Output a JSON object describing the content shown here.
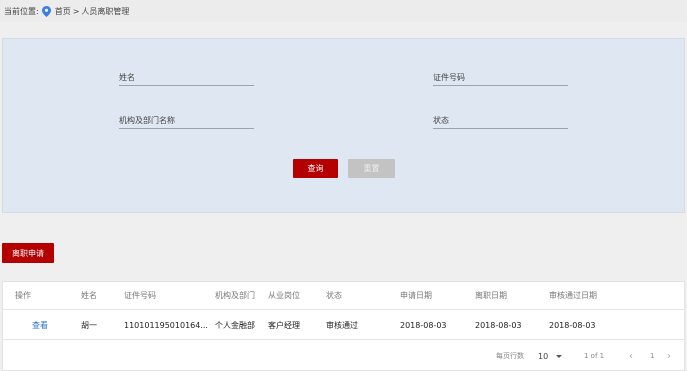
{
  "breadcrumb": {
    "label": "当前位置:",
    "home": "首页",
    "separator": ">",
    "current": "人员离职管理"
  },
  "search": {
    "name_placeholder": "姓名",
    "id_placeholder": "证件号码",
    "org_placeholder": "机构及部门名称",
    "status_placeholder": "状态",
    "query_label": "查询",
    "reset_label": "重置"
  },
  "actions": {
    "resign_label": "离职申请"
  },
  "table": {
    "columns": [
      "操作",
      "姓名",
      "证件号码",
      "机构及部门",
      "从业岗位",
      "状态",
      "申请日期",
      "离职日期",
      "审核通过日期"
    ],
    "rows": [
      {
        "action": "查看",
        "name": "胡一",
        "id_number": "110101195010164...",
        "org": "个人金融部",
        "position": "客户经理",
        "status": "审核通过",
        "apply_date": "2018-08-03",
        "leave_date": "2018-08-03",
        "approve_date": "2018-08-03"
      }
    ]
  },
  "pagination": {
    "rows_per_page_label": "每页行数",
    "page_size": "10",
    "range": "1 of 1",
    "current_page": "1",
    "prev_icon": "chevron-left-icon",
    "next_icon": "chevron-right-icon"
  },
  "colors": {
    "primary": "#b40000",
    "panel": "#dfe7f2",
    "link": "#2a6fd6"
  }
}
